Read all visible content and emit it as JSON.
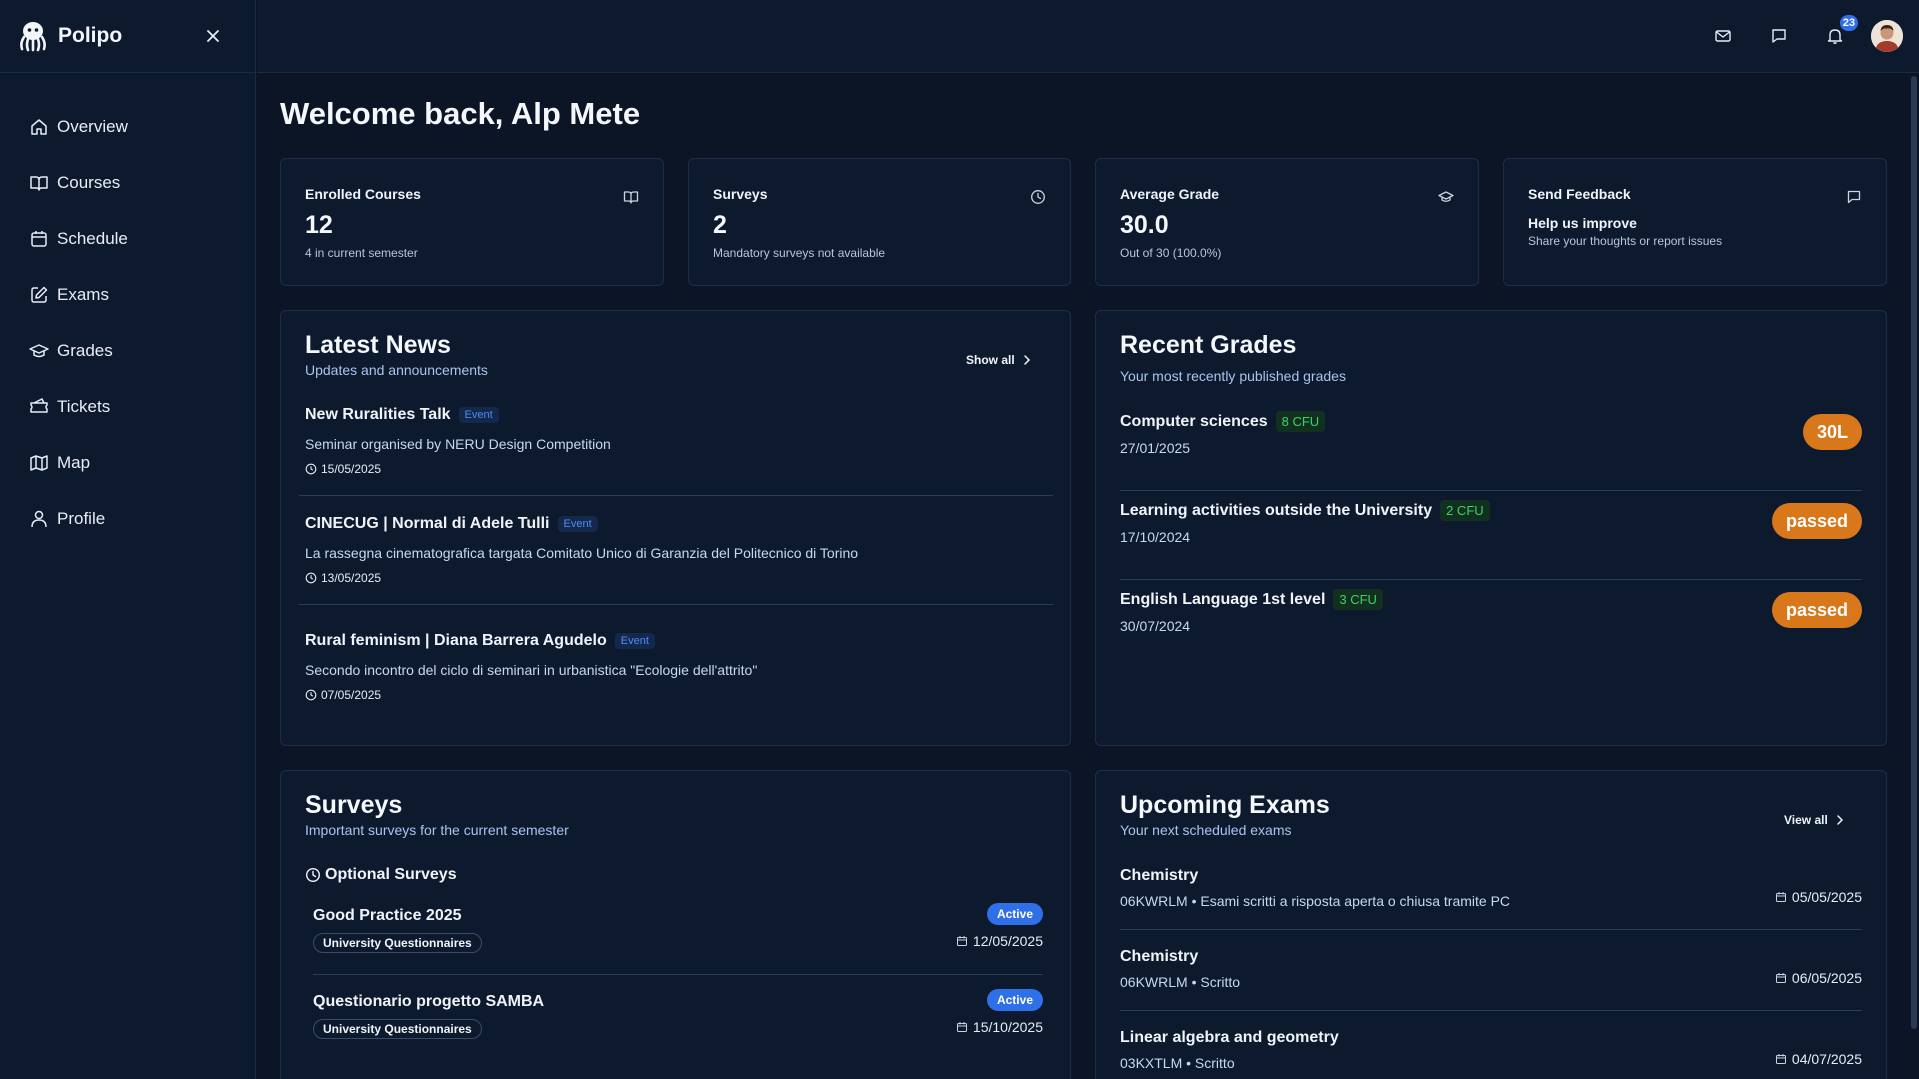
{
  "brand": {
    "name": "Polipo"
  },
  "sidebar": {
    "items": [
      {
        "label": "Overview",
        "icon": "home-icon"
      },
      {
        "label": "Courses",
        "icon": "book-icon"
      },
      {
        "label": "Schedule",
        "icon": "calendar-icon"
      },
      {
        "label": "Exams",
        "icon": "edit-icon"
      },
      {
        "label": "Grades",
        "icon": "graduation-cap-icon"
      },
      {
        "label": "Tickets",
        "icon": "ticket-icon"
      },
      {
        "label": "Map",
        "icon": "map-icon"
      },
      {
        "label": "Profile",
        "icon": "user-icon"
      }
    ]
  },
  "header": {
    "notification_count": "23"
  },
  "main": {
    "title": "Welcome back, Alp Mete",
    "stats": [
      {
        "title": "Enrolled Courses",
        "value": "12",
        "sub": "4 in current semester"
      },
      {
        "title": "Surveys",
        "value": "2",
        "sub": "Mandatory surveys not available"
      },
      {
        "title": "Average Grade",
        "value": "30.0",
        "sub": "Out of 30 (100.0%)"
      }
    ],
    "feedback": {
      "title": "Send Feedback",
      "heading": "Help us improve",
      "sub": "Share your thoughts or report issues"
    }
  },
  "news": {
    "title": "Latest News",
    "subtitle": "Updates and announcements",
    "show_all": "Show all",
    "items": [
      {
        "title": "New Ruralities Talk",
        "tag": "Event",
        "desc": "Seminar organised by NERU Design Competition",
        "date": "15/05/2025"
      },
      {
        "title": "CINECUG | Normal di Adele Tulli",
        "tag": "Event",
        "desc": "La rassegna cinematografica targata Comitato Unico di Garanzia del Politecnico di Torino",
        "date": "13/05/2025"
      },
      {
        "title": "Rural feminism | Diana Barrera Agudelo",
        "tag": "Event",
        "desc": "Secondo incontro del ciclo di seminari in urbanistica \"Ecologie dell'attrito\"",
        "date": "07/05/2025"
      }
    ]
  },
  "grades": {
    "title": "Recent Grades",
    "subtitle": "Your most recently published grades",
    "items": [
      {
        "name": "Computer sciences",
        "cfu": "8 CFU",
        "date": "27/01/2025",
        "grade": "30L"
      },
      {
        "name": "Learning activities outside the University",
        "cfu": "2 CFU",
        "date": "17/10/2024",
        "grade": "passed"
      },
      {
        "name": "English Language 1st level",
        "cfu": "3 CFU",
        "date": "30/07/2024",
        "grade": "passed"
      }
    ]
  },
  "surveys": {
    "title": "Surveys",
    "subtitle": "Important surveys for the current semester",
    "section": "Optional Surveys",
    "items": [
      {
        "name": "Good Practice 2025",
        "tag": "University Questionnaires",
        "status": "Active",
        "date": "12/05/2025"
      },
      {
        "name": "Questionario progetto SAMBA",
        "tag": "University Questionnaires",
        "status": "Active",
        "date": "15/10/2025"
      }
    ]
  },
  "exams": {
    "title": "Upcoming Exams",
    "subtitle": "Your next scheduled exams",
    "view_all": "View all",
    "items": [
      {
        "name": "Chemistry",
        "sub": "06KWRLM • Esami scritti a risposta aperta o chiusa tramite PC",
        "date": "05/05/2025"
      },
      {
        "name": "Chemistry",
        "sub": "06KWRLM • Scritto",
        "date": "06/05/2025"
      },
      {
        "name": "Linear algebra and geometry",
        "sub": "03KXTLM • Scritto",
        "date": "04/07/2025"
      }
    ]
  },
  "colors": {
    "accent": "#2f6fe8",
    "grade_pill": "#d8781a",
    "cfu_green": "#3fcf6a",
    "background": "#0b1526"
  }
}
